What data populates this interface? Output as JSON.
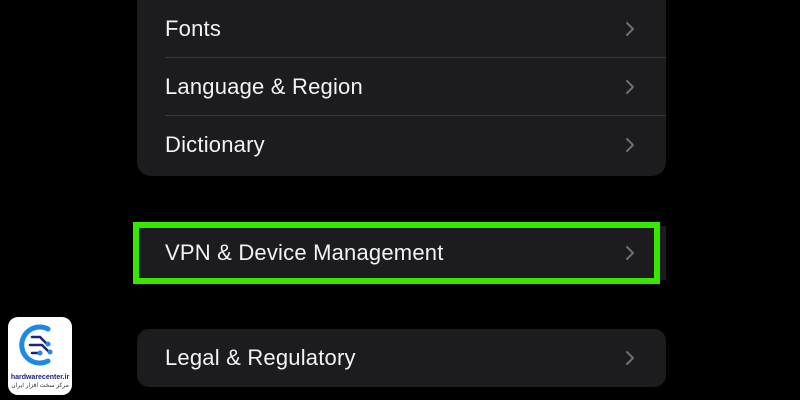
{
  "settings": {
    "top_group": [
      {
        "label": "Fonts"
      },
      {
        "label": "Language & Region"
      },
      {
        "label": "Dictionary"
      }
    ],
    "vpn_item": {
      "label": "VPN & Device Management"
    },
    "legal_item": {
      "label": "Legal & Regulatory"
    }
  },
  "highlight": {
    "color": "#39e600"
  },
  "watermark": {
    "brand": "hardwarecenter.ir",
    "tagline": "مرکز سخت افزار ایران"
  },
  "icons": {
    "row_chevron": "chevron-right-icon",
    "logo": "circuit-logo-icon"
  }
}
